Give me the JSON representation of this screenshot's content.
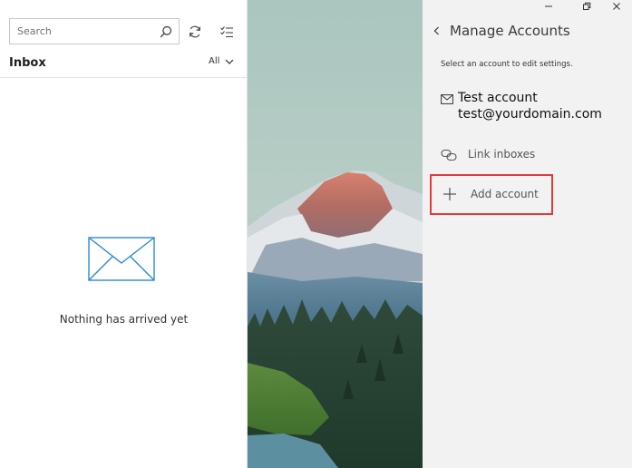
{
  "mail_list": {
    "search": {
      "placeholder": "Search",
      "value": ""
    },
    "folder_title": "Inbox",
    "filter_label": "All",
    "empty_message": "Nothing has arrived yet",
    "icons": {
      "search": "search-icon",
      "sync": "sync-icon",
      "select": "select-mode-icon",
      "filter_chevron": "chevron-down-icon",
      "empty": "envelope-icon"
    }
  },
  "window": {
    "buttons": [
      "minimize",
      "restore",
      "close"
    ]
  },
  "manage_accounts": {
    "title": "Manage Accounts",
    "hint": "Select an account to edit settings.",
    "accounts": [
      {
        "name": "Test account",
        "email": "test@yourdomain.com",
        "icon": "mail-icon"
      }
    ],
    "link_inboxes_label": "Link inboxes",
    "add_account_label": "Add account",
    "highlight_color": "#e23b3b"
  }
}
